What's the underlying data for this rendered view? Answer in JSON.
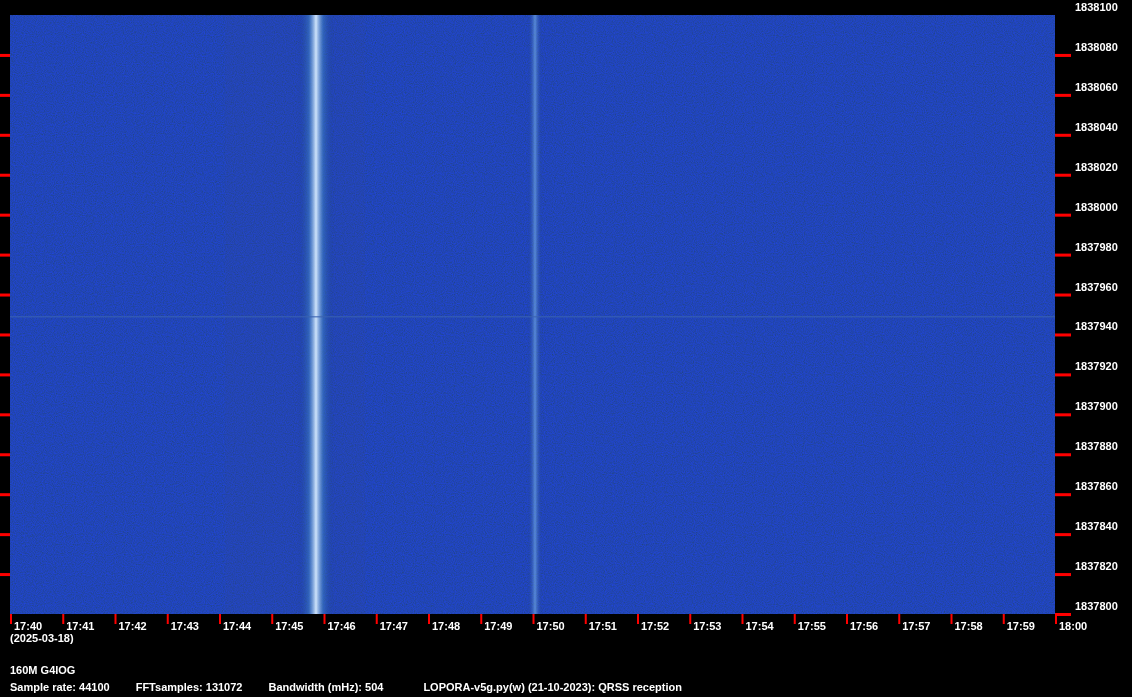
{
  "plot": {
    "y_axis": {
      "tick_labels": [
        "1838100",
        "1838080",
        "1838060",
        "1838040",
        "1838020",
        "1838000",
        "1837980",
        "1837960",
        "1837940",
        "1837920",
        "1837900",
        "1837880",
        "1837860",
        "1837840",
        "1837820",
        "1837800"
      ]
    },
    "x_axis": {
      "tick_labels": [
        "17:40",
        "17:41",
        "17:42",
        "17:43",
        "17:44",
        "17:45",
        "17:46",
        "17:47",
        "17:48",
        "17:49",
        "17:50",
        "17:51",
        "17:52",
        "17:53",
        "17:54",
        "17:55",
        "17:56",
        "17:57",
        "17:58",
        "17:59",
        "18:00"
      ]
    },
    "date": "(2025-03-18)"
  },
  "station": "160M G4IOG",
  "info": [
    "Sample rate: 44100",
    "FFTsamples: 131072",
    "Bandwidth (mHz): 504",
    "LOPORA-v5g.py(w) (21-10-2023): QRSS reception"
  ]
}
